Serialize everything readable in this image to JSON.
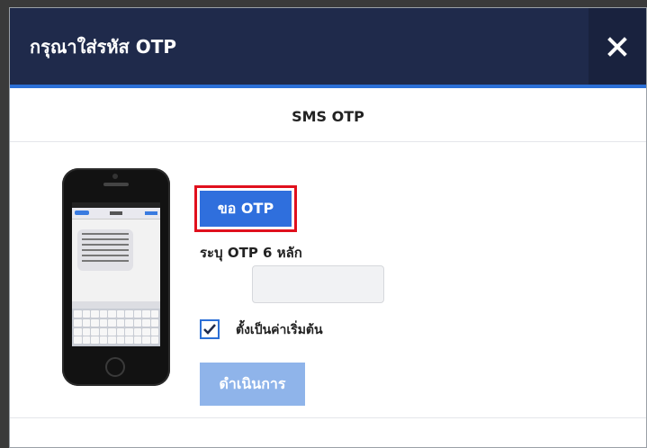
{
  "dialog": {
    "title": "กรุณาใส่รหัส OTP",
    "close_icon": "close-icon"
  },
  "section": {
    "title": "SMS OTP"
  },
  "phone_image": {
    "icon": "smartphone-sms-icon"
  },
  "request_otp_button": {
    "label": "ขอ OTP",
    "highlight_color": "#e0101d"
  },
  "otp_field": {
    "label": "ระบุ OTP 6 หลัก",
    "value": "",
    "placeholder": ""
  },
  "default_checkbox": {
    "checked": true,
    "label": "ตั้งเป็นค่าเริ่มต้น"
  },
  "proceed_button": {
    "label": "ดำเนินการ",
    "disabled": true
  },
  "colors": {
    "header_bg": "#1f2a4b",
    "accent": "#2f6fdd",
    "disabled_button": "#8fb4ea"
  }
}
